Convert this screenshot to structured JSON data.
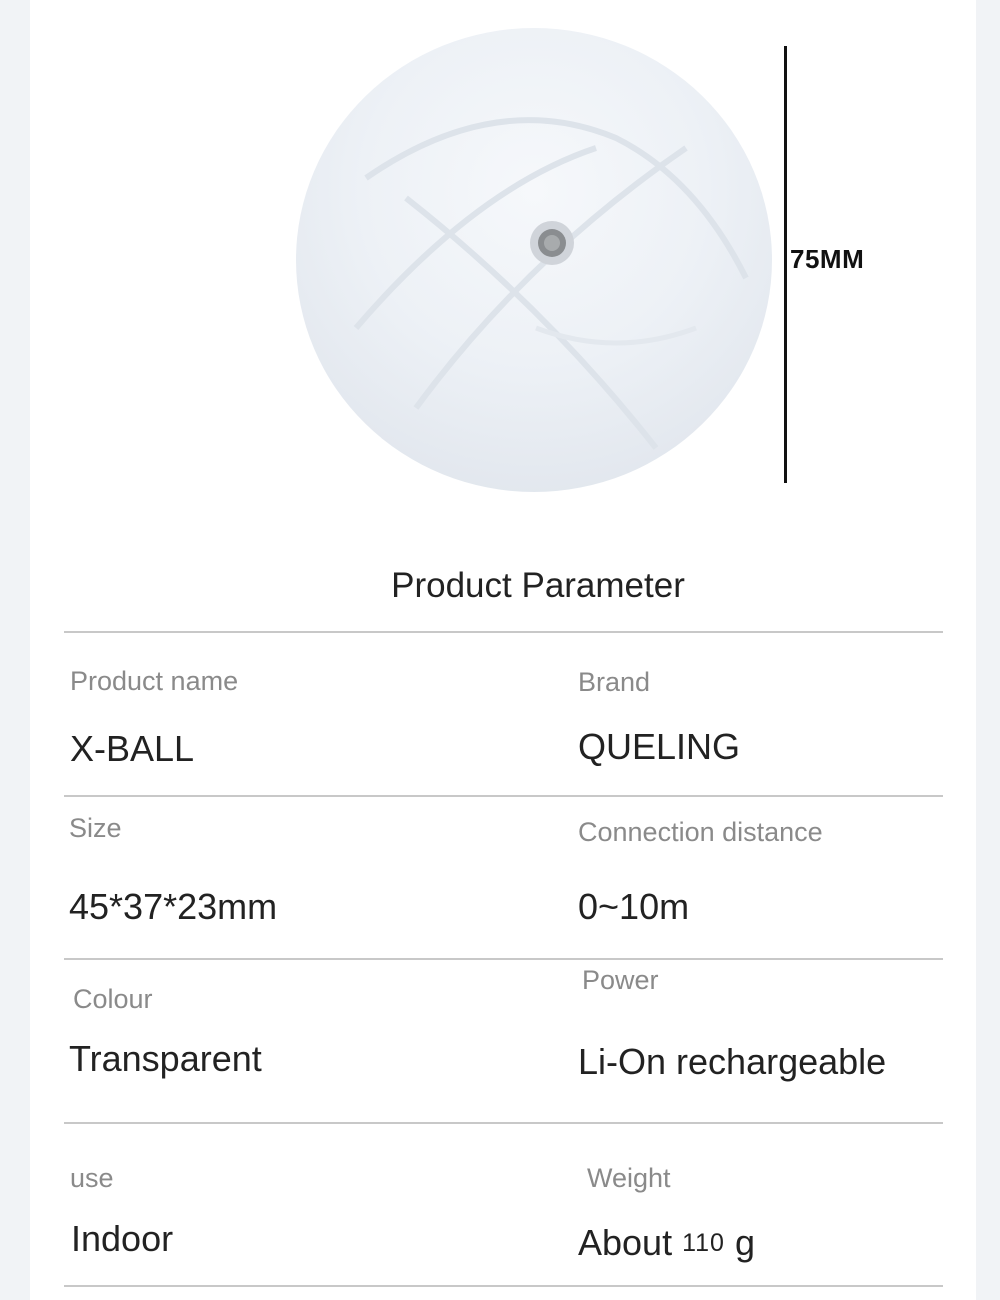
{
  "product_image": {
    "dimension_label": "75MM",
    "subject": "ball-icon"
  },
  "parameters": {
    "title": "Product Parameter",
    "rows": [
      {
        "left": {
          "label": "Product name",
          "value": "X-BALL"
        },
        "right": {
          "label": "Brand",
          "value": "QUELING"
        }
      },
      {
        "left": {
          "label": "Size",
          "value": "45*37*23mm"
        },
        "right": {
          "label": "Connection distance",
          "value": "0~10m"
        }
      },
      {
        "left": {
          "label": "Colour",
          "value": "Transparent"
        },
        "right": {
          "label": "Power",
          "value": "Li-On rechargeable"
        }
      },
      {
        "left": {
          "label": "use",
          "value": "Indoor"
        },
        "right": {
          "label": "Weight",
          "value_prefix": "About",
          "value_number": "110",
          "value_unit": "g"
        }
      }
    ]
  }
}
